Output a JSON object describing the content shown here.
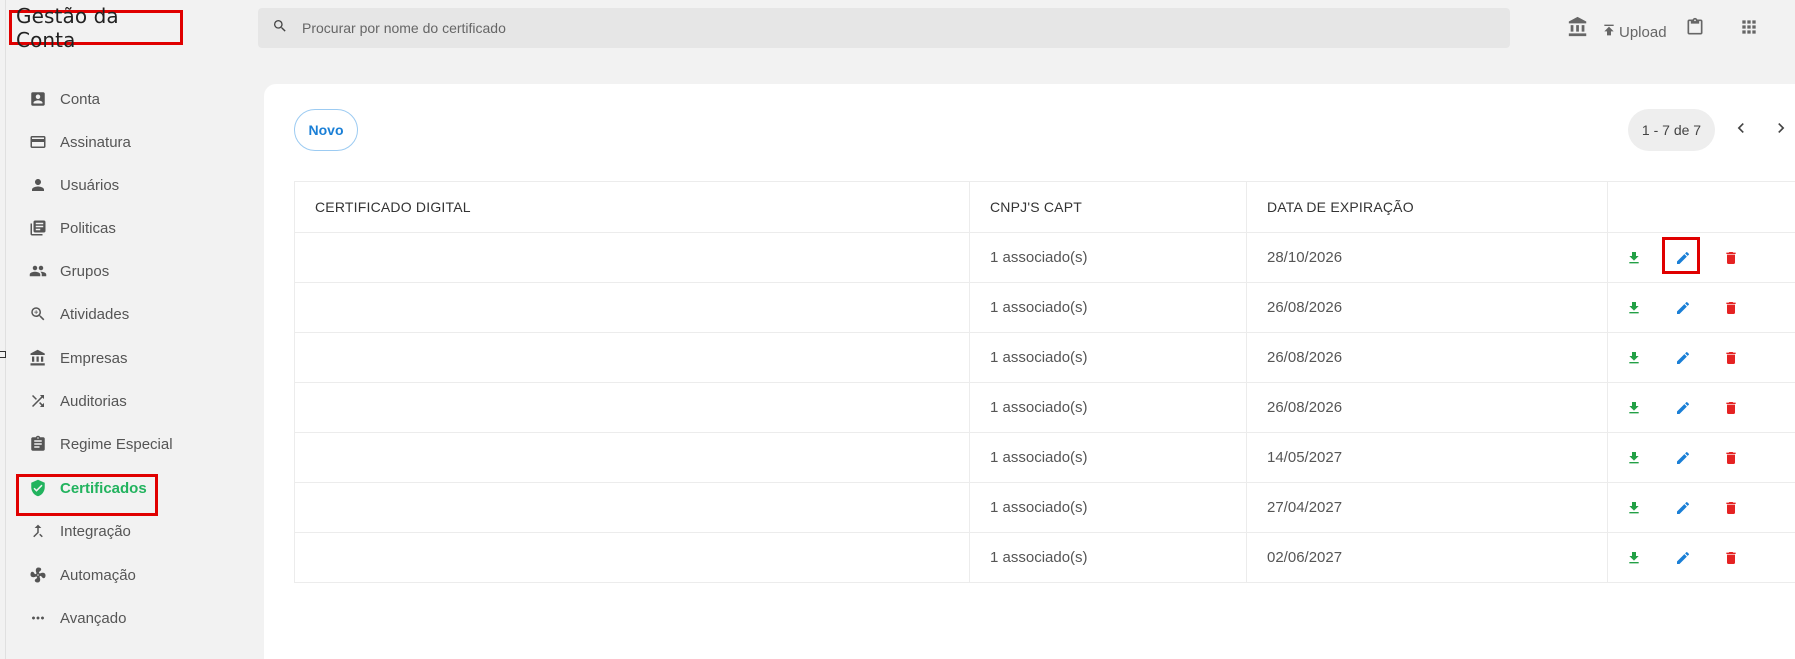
{
  "header": {
    "title": "Gestão da Conta",
    "search_placeholder": "Procurar por nome do certificado",
    "upload_label": "Upload",
    "icons": [
      "bank-icon",
      "upload-icon",
      "clipboard-icon",
      "apps-grid-icon"
    ]
  },
  "sidebar": {
    "items": [
      {
        "label": "Conta",
        "icon": "account-box-icon"
      },
      {
        "label": "Assinatura",
        "icon": "credit-card-icon"
      },
      {
        "label": "Usuários",
        "icon": "person-icon"
      },
      {
        "label": "Politicas",
        "icon": "library-books-icon"
      },
      {
        "label": "Grupos",
        "icon": "people-icon"
      },
      {
        "label": "Atividades",
        "icon": "zoom-search-icon"
      },
      {
        "label": "Empresas",
        "icon": "bank-icon"
      },
      {
        "label": "Auditorias",
        "icon": "shuffle-icon"
      },
      {
        "label": "Regime Especial",
        "icon": "assignment-icon"
      },
      {
        "label": "Certificados",
        "icon": "verified-shield-icon",
        "active": true
      },
      {
        "label": "Integração",
        "icon": "merge-icon"
      },
      {
        "label": "Automação",
        "icon": "fan-icon"
      },
      {
        "label": "Avançado",
        "icon": "more-horiz-icon"
      }
    ],
    "active_color": "#22b35e"
  },
  "main": {
    "new_button": "Novo",
    "pagination": "1 - 7 de 7",
    "columns": [
      "CERTIFICADO DIGITAL",
      "CNPJ'S CAPT",
      "DATA DE EXPIRAÇÃO",
      ""
    ],
    "rows": [
      {
        "certificate": "",
        "cnpjs": "1 associado(s)",
        "expiration": "28/10/2026"
      },
      {
        "certificate": "",
        "cnpjs": "1 associado(s)",
        "expiration": "26/08/2026"
      },
      {
        "certificate": "",
        "cnpjs": "1 associado(s)",
        "expiration": "26/08/2026"
      },
      {
        "certificate": "",
        "cnpjs": "1 associado(s)",
        "expiration": "26/08/2026"
      },
      {
        "certificate": "",
        "cnpjs": "1 associado(s)",
        "expiration": "14/05/2027"
      },
      {
        "certificate": "",
        "cnpjs": "1 associado(s)",
        "expiration": "27/04/2027"
      },
      {
        "certificate": "",
        "cnpjs": "1 associado(s)",
        "expiration": "02/06/2027"
      }
    ],
    "row_actions": [
      "download-icon",
      "edit-pencil-icon",
      "delete-trash-icon"
    ]
  },
  "colors": {
    "highlight": "#e00000",
    "download": "#22a045",
    "edit": "#1a7fd6",
    "delete": "#e52222"
  }
}
